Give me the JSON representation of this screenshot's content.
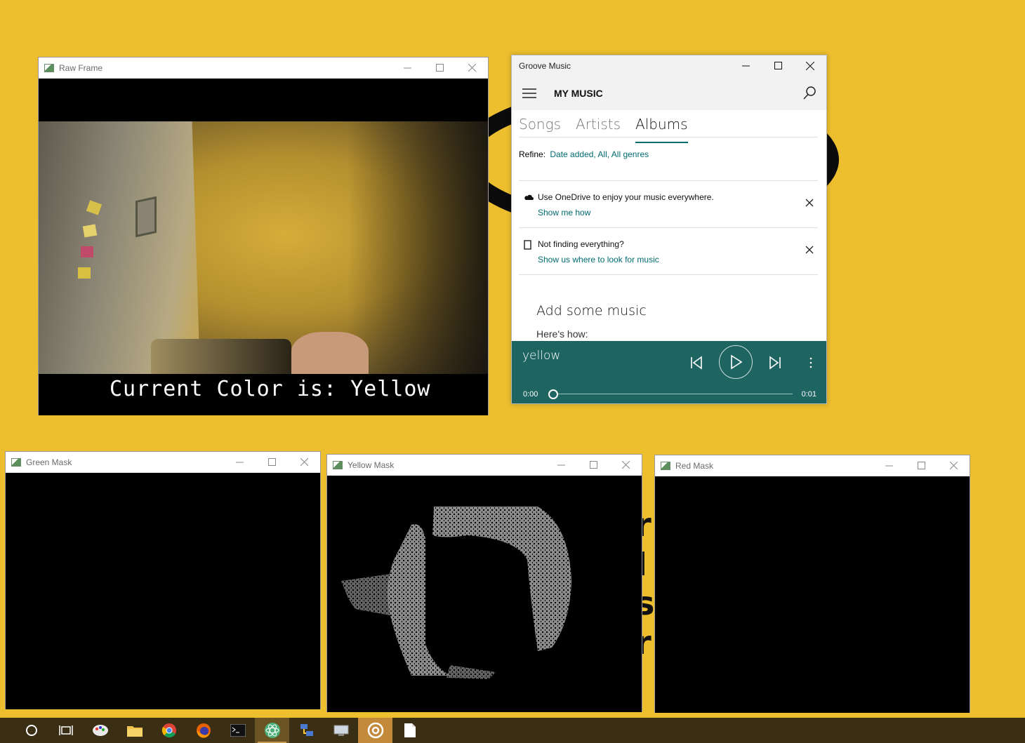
{
  "desktop": {
    "background_color": "#EDBE2E"
  },
  "raw_frame": {
    "title": "Raw Frame",
    "caption": "Current Color is: Yellow"
  },
  "groove": {
    "title": "Groove Music",
    "header": "MY MUSIC",
    "tabs": [
      "Songs",
      "Artists",
      "Albums"
    ],
    "active_tab": "Albums",
    "refine_label": "Refine:",
    "refine_value": "Date added, All, All genres",
    "notices": [
      {
        "icon": "cloud-icon",
        "text": "Use OneDrive to enjoy your music everywhere.",
        "link": "Show me how"
      },
      {
        "icon": "folder-icon",
        "text": "Not finding everything?",
        "link": "Show us where to look for music"
      }
    ],
    "add_heading": "Add some music",
    "add_sub": "Here's how:",
    "player": {
      "song": "yellow",
      "elapsed": "0:00",
      "duration": "0:01",
      "progress": 0.0
    },
    "accent": "#1e6461"
  },
  "masks": [
    {
      "title": "Green Mask"
    },
    {
      "title": "Yellow Mask"
    },
    {
      "title": "Red Mask"
    }
  ],
  "taskbar": {
    "items": [
      "cortana-icon",
      "task-view-icon",
      "paint-icon",
      "file-explorer-icon",
      "chrome-icon",
      "firefox-icon",
      "terminal-icon",
      "atom-icon",
      "network-icon",
      "remote-icon",
      "groove-music-icon",
      "notepad-icon"
    ]
  }
}
